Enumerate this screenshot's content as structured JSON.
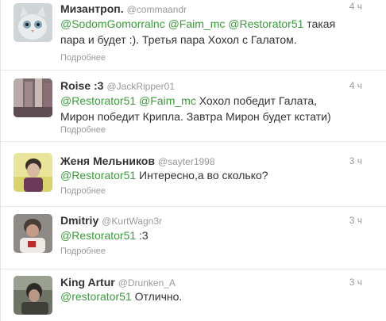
{
  "tweets": [
    {
      "fullname": "Мизантроп.",
      "username": "@commaandr",
      "time": "4 ч",
      "mention1": "@SodomGomorralnc",
      "mention2": "@Faim_mc",
      "mention3": "@Restorator51",
      "text_rest": " такая",
      "text_line2": "пара и будет :). Третья пара Хохол с Галатом.",
      "expand": "Подробнее"
    },
    {
      "fullname": "Roise :3",
      "username": "@JackRipper01",
      "time": "4 ч",
      "mention1": "@Restorator51",
      "mention2": "@Faim_mc",
      "text_rest": " Хохол победит Галата,",
      "text_line2": "Мирон победит Крипла. Завтра Мирон будет кстати)",
      "expand": "Подробнее"
    },
    {
      "fullname": "Женя Мельников",
      "username": "@sayter1998",
      "time": "3 ч",
      "mention1": "@Restorator51",
      "text_rest": " Интересно,а во сколько?",
      "expand": "Подробнее"
    },
    {
      "fullname": "Dmitriy",
      "username": "@KurtWagn3r",
      "time": "3 ч",
      "mention1": "@Restorator51",
      "text_rest": " :3",
      "expand": "Подробнее"
    },
    {
      "fullname": "King Artur",
      "username": "@Drunken_A",
      "time": "3 ч",
      "mention1": "@restorator51",
      "text_rest": " Отлично.",
      "expand": ""
    }
  ]
}
